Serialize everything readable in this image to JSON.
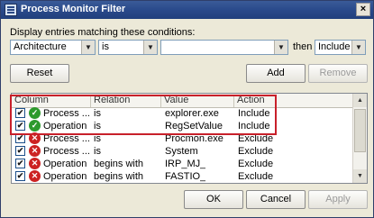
{
  "window": {
    "title": "Process Monitor Filter",
    "close_glyph": "×"
  },
  "conditions": {
    "prompt": "Display entries matching these conditions:",
    "column_value": "Architecture",
    "relation_value": "is",
    "value_text": "",
    "then_label": "then",
    "action_value": "Include"
  },
  "buttons": {
    "reset": "Reset",
    "add": "Add",
    "remove": "Remove",
    "ok": "OK",
    "cancel": "Cancel",
    "apply": "Apply"
  },
  "table": {
    "headers": [
      "Column",
      "Relation",
      "Value",
      "Action"
    ],
    "rows": [
      {
        "checked": true,
        "status": "include",
        "column": "Process ...",
        "relation": "is",
        "value": "explorer.exe",
        "action": "Include"
      },
      {
        "checked": true,
        "status": "include",
        "column": "Operation",
        "relation": "is",
        "value": "RegSetValue",
        "action": "Include"
      },
      {
        "checked": true,
        "status": "exclude",
        "column": "Process ...",
        "relation": "is",
        "value": "Procmon.exe",
        "action": "Exclude"
      },
      {
        "checked": true,
        "status": "exclude",
        "column": "Process ...",
        "relation": "is",
        "value": "System",
        "action": "Exclude"
      },
      {
        "checked": true,
        "status": "exclude",
        "column": "Operation",
        "relation": "begins with",
        "value": "IRP_MJ_",
        "action": "Exclude"
      },
      {
        "checked": true,
        "status": "exclude",
        "column": "Operation",
        "relation": "begins with",
        "value": "FASTIO_",
        "action": "Exclude"
      }
    ]
  },
  "glyphs": {
    "check": "✔",
    "ok_mark": "✓",
    "x_mark": "✕",
    "arrow_down": "▼",
    "arrow_up": "▲"
  },
  "colors": {
    "title_bar": "#2a4a8b",
    "include_icon": "#2d9a2d",
    "exclude_icon": "#cc2222",
    "highlight": "#c8202a"
  }
}
